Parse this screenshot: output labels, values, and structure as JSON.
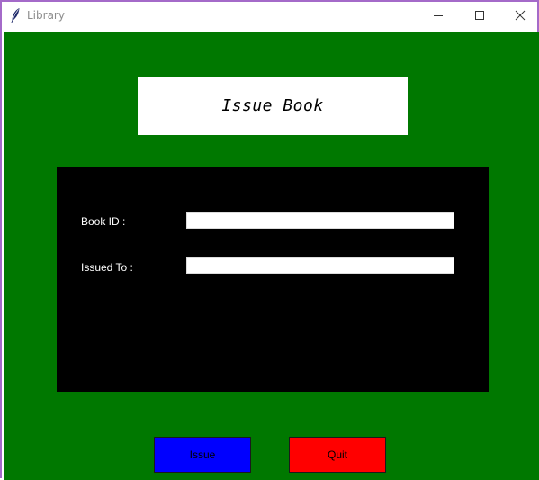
{
  "window": {
    "title": "Library",
    "icon": "feather-icon"
  },
  "titlebar_controls": [
    "minimize-icon",
    "maximize-icon",
    "close-icon"
  ],
  "heading": {
    "text": "Issue Book"
  },
  "form": {
    "book_id": {
      "label": "Book ID :",
      "value": ""
    },
    "issued_to": {
      "label": "Issued To :",
      "value": ""
    }
  },
  "buttons": {
    "issue_label": "Issue",
    "quit_label": "Quit"
  },
  "colors": {
    "background": "#007800",
    "panel": "#000000",
    "issue_button": "#0000ff",
    "quit_button": "#ff0000",
    "window_border": "#a46ac9"
  }
}
